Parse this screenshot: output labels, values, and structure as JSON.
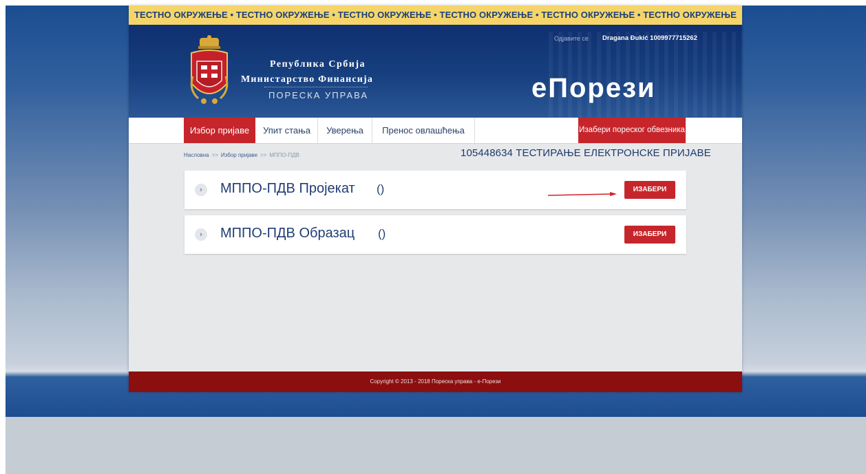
{
  "test_banner": {
    "text": "ТЕСТНО ОКРУЖЕЊЕ  •  ТЕСТНО ОКРУЖЕЊЕ  •  ТЕСТНО ОКРУЖЕЊЕ  •  ТЕСТНО ОКРУЖЕЊЕ  •  ТЕСТНО ОКРУЖЕЊЕ  •  ТЕСТНО ОКРУЖЕЊЕ"
  },
  "header": {
    "org_line1": "Република Србија",
    "org_line2": "Министарство Финансија",
    "org_line3": "ПОРЕСКА УПРАВА",
    "logout": "Одјавите се",
    "user": "Dragana Đukić 1009977715262",
    "brand": "еПорези"
  },
  "nav": {
    "items": [
      {
        "label": "Избор пријаве",
        "active": true
      },
      {
        "label": "Упит стања",
        "active": false
      },
      {
        "label": "Уверења",
        "active": false
      },
      {
        "label": "Пренос овлашћења",
        "active": false
      }
    ],
    "select_taxpayer": "Изабери пореског обвезника"
  },
  "breadcrumb": {
    "items": [
      "Насловна",
      "Избор пријаве",
      "МППО-ПДВ"
    ],
    "separator": ">>"
  },
  "taxpayer_title": "105448634 ТЕСТИРАЊЕ ЕЛЕКТРОНСКЕ ПРИЈАВЕ",
  "forms": [
    {
      "title": "МППО-ПДВ Пројекат",
      "count": "()",
      "button": "ИЗАБЕРИ"
    },
    {
      "title": "МППО-ПДВ Образац",
      "count": "()",
      "button": "ИЗАБЕРИ"
    }
  ],
  "footer": {
    "copyright": "Copyright © 2013 - 2018 Пореска управа - е-Порези"
  },
  "colors": {
    "accent_red": "#c6262b",
    "navy": "#1f3e74",
    "banner_yellow": "#f5d56a",
    "footer_red": "#8b0f0f"
  }
}
